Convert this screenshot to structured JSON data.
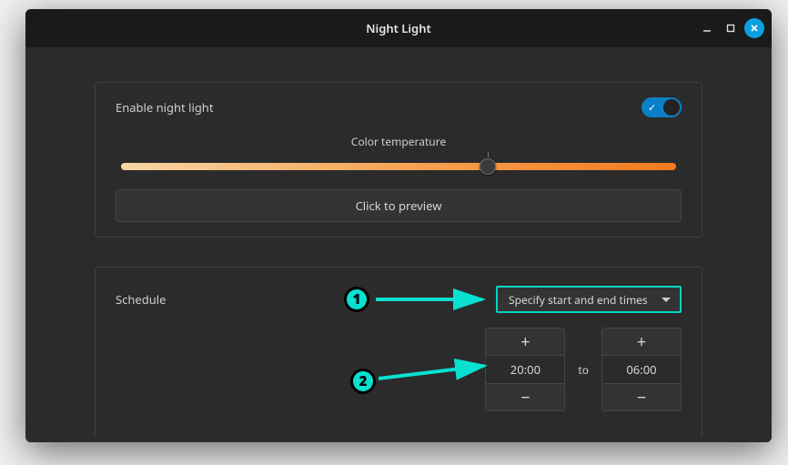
{
  "window": {
    "title": "Night Light"
  },
  "panel1": {
    "enable_label": "Enable night light",
    "toggle_on": true,
    "color_temp_label": "Color temperature",
    "slider_percent": 66,
    "preview_label": "Click to preview"
  },
  "schedule": {
    "label": "Schedule",
    "dropdown_value": "Specify start and end times",
    "start_time": "20:00",
    "to_label": "to",
    "end_time": "06:00"
  },
  "annotations": {
    "badge1": "1",
    "badge2": "2"
  }
}
